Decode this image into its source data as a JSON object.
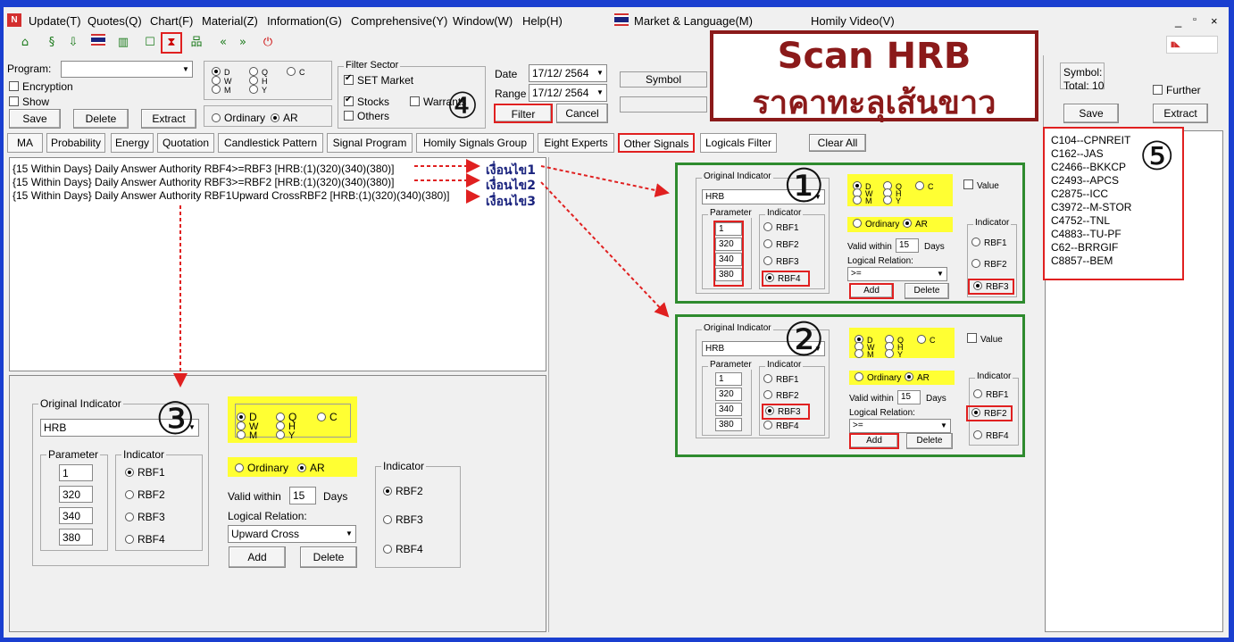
{
  "menu": [
    "Update(T)",
    "Quotes(Q)",
    "Chart(F)",
    "Material(Z)",
    "Information(G)",
    "Comprehensive(Y)",
    "Window(W)",
    "Help(H)",
    "Market & Language(M)",
    "Homily Video(V)"
  ],
  "window_controls": [
    "_",
    "▫",
    "×"
  ],
  "toolbar_icons": [
    "home-icon",
    "s-arrow-icon",
    "download-icon",
    "flag-icon",
    "bar-chart-icon",
    "export-icon",
    "hourglass-icon",
    "network-icon",
    "rewind-icon",
    "fast-forward-icon",
    "power-icon"
  ],
  "program": {
    "label": "Program:",
    "value": "",
    "encryption": "Encryption",
    "show": "Show",
    "save": "Save",
    "delete": "Delete",
    "extract": "Extract"
  },
  "period": {
    "d": "D",
    "q": "Q",
    "c": "C",
    "w": "W",
    "h": "H",
    "m": "M",
    "y": "Y",
    "ordinary": "Ordinary",
    "ar": "AR"
  },
  "filter_sector": {
    "title": "Filter Sector",
    "set_market": "SET Market",
    "stocks": "Stocks",
    "warrants": "Warrants",
    "others": "Others",
    "filter": "Filter",
    "cancel": "Cancel"
  },
  "date": {
    "date_label": "Date",
    "date_value": "17/12/ 2564",
    "range_label": "Range",
    "range_value": "17/12/ 2564",
    "symbol": "Symbol"
  },
  "right_panel": {
    "symbol_label": "Symbol:",
    "total": "Total: 10",
    "further": "Further",
    "save": "Save",
    "extract": "Extract"
  },
  "results": [
    "C104--CPNREIT",
    "C162--JAS",
    "C2466--BKKCP",
    "C2493--APCS",
    "C2875--ICC",
    "C3972--M-STOR",
    "C4752--TNL",
    "C4883--TU-PF",
    "C62--BRRGIF",
    "C8857--BEM"
  ],
  "tabs": [
    "MA",
    "Probability",
    "Energy",
    "Quotation",
    "Candlestick Pattern",
    "Signal Program",
    "Homily Signals Group",
    "Eight  Experts",
    "Other Signals",
    "Logicals Filter"
  ],
  "clear_all": "Clear All",
  "conditions": [
    "{15 Within Days}  Daily  Answer Authority  RBF4>=RBF3  [HRB:(1)(320)(340)(380)]",
    "{15 Within Days}  Daily  Answer Authority  RBF3>=RBF2  [HRB:(1)(320)(340)(380)]",
    "{15 Within Days}  Daily  Answer Authority  RBF1Upward CrossRBF2  [HRB:(1)(320)(340)(380)]"
  ],
  "thai_labels": [
    "เงื่อนไข1",
    "เงื่อนไข2",
    "เงื่อนไข3"
  ],
  "banner": {
    "title": "Scan HRB",
    "subtitle": "ราคาทะลุเส้นขาว"
  },
  "steps": [
    "①",
    "②",
    "③",
    "④",
    "⑤"
  ],
  "indicator_form": {
    "original_indicator": "Original Indicator",
    "indicator_value": "HRB",
    "parameter": "Parameter",
    "indicator": "Indicator",
    "params": [
      "1",
      "320",
      "340",
      "380"
    ],
    "rbf": [
      "RBF1",
      "RBF2",
      "RBF3",
      "RBF4"
    ],
    "valid_within": "Valid within",
    "days_value": "15",
    "days": "Days",
    "logical_relation": "Logical Relation:",
    "add": "Add",
    "delete": "Delete",
    "value": "Value"
  },
  "form1": {
    "relation": ">="
  },
  "form2": {
    "relation": ">="
  },
  "form3": {
    "relation": "Upward Cross"
  }
}
